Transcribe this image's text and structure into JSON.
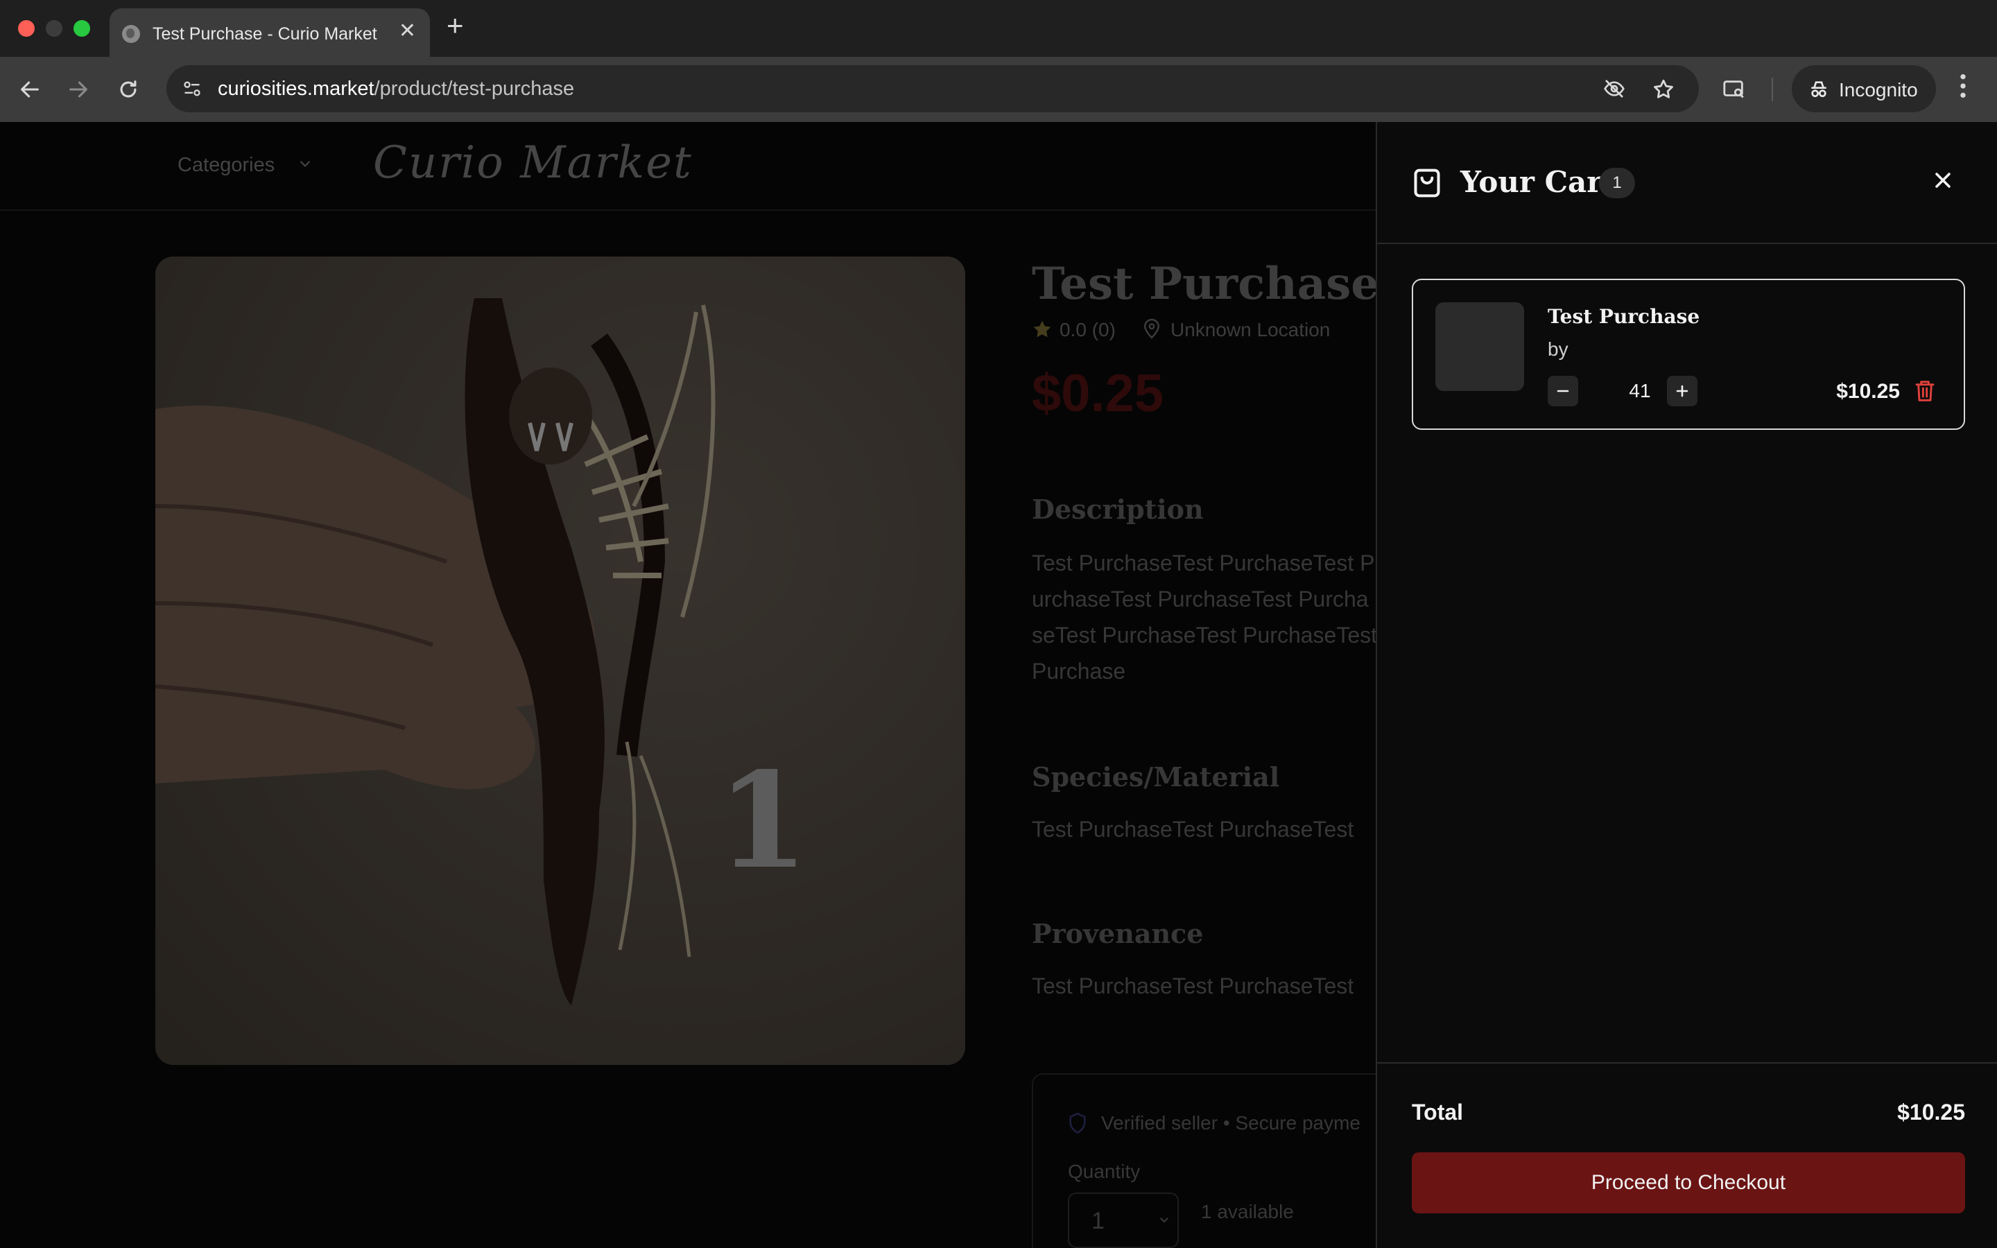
{
  "browser": {
    "tab_title": "Test Purchase - Curio Market",
    "url_host": "curiosities.market",
    "url_path": "/product/test-purchase",
    "incognito_label": "Incognito"
  },
  "site": {
    "categories_label": "Categories",
    "logo_main": "Curio",
    "logo_second": "Market"
  },
  "product": {
    "title": "Test Purchase",
    "rating": "0.0 (0)",
    "location": "Unknown Location",
    "price": "$0.25",
    "description_heading": "Description",
    "description_text": "Test PurchaseTest PurchaseTest PurchaseTest PurchaseTest PurchaseTest PurchaseTest PurchaseTest Purchase",
    "species_heading": "Species/Material",
    "species_text": "Test PurchaseTest PurchaseTest",
    "provenance_heading": "Provenance",
    "provenance_text": "Test PurchaseTest PurchaseTest",
    "image_number": "1",
    "verified_text": "Verified seller • Secure payme",
    "quantity_label": "Quantity",
    "quantity_value": "1",
    "available_text": "1 available"
  },
  "cart": {
    "title": "Your Cart",
    "count": "1",
    "items": [
      {
        "name": "Test Purchase",
        "by": "by",
        "quantity": "41",
        "price": "$10.25"
      }
    ],
    "total_label": "Total",
    "total_value": "$10.25",
    "checkout_label": "Proceed to Checkout"
  },
  "colors": {
    "accent": "#6b1414",
    "price": "#8b1a1a",
    "trash": "#e0413c"
  },
  "icons": [
    "back-icon",
    "forward-icon",
    "reload-icon",
    "site-info-icon",
    "eye-off-icon",
    "star-icon",
    "lens-icon",
    "incognito-icon",
    "kebab-icon",
    "chevron-down-icon",
    "location-pin-icon",
    "shield-icon",
    "shopping-bag-icon",
    "close-icon",
    "minus-icon",
    "plus-icon",
    "trash-icon"
  ]
}
